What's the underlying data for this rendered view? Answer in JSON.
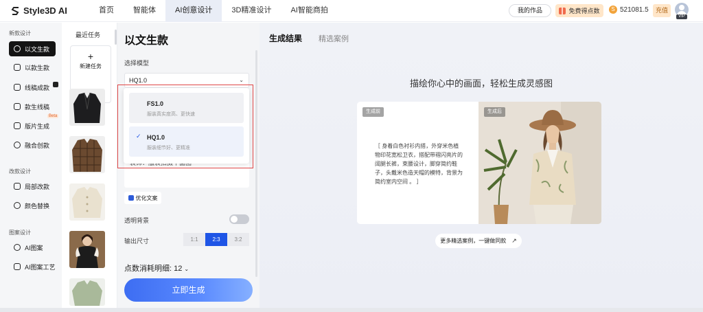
{
  "header": {
    "logo_text": "Style3D AI",
    "nav": [
      "首页",
      "智能体",
      "AI创意设计",
      "3D精准设计",
      "AI智能商拍"
    ],
    "works_label": "我的作品",
    "free_points_label": "免费得点数",
    "balance": "521081.5",
    "recharge_label": "充值",
    "vip_label": "VIP"
  },
  "sidebar": {
    "group1": "新款设计",
    "group2": "改款设计",
    "group3": "图案设计",
    "items": [
      "以文生款",
      "以款生款",
      "线稿成款",
      "款生线稿",
      "版片生成",
      "融合创款",
      "局部改款",
      "颜色替换",
      "AI图案",
      "AI图案工艺"
    ],
    "beta": "Beta"
  },
  "recent": {
    "title": "最近任务",
    "new_task": "新建任务"
  },
  "config": {
    "title": "以文生款",
    "model_label": "选择模型",
    "model_value": "HQ1.0",
    "prompt_text": "装饰：服装拍摄平面图",
    "optimize_label": "优化文案",
    "transparent_label": "透明背景",
    "size_label": "输出尺寸",
    "ratios": [
      "1:1",
      "2:3",
      "3:2"
    ],
    "cost_label": "点数消耗明细: 12",
    "generate_label": "立即生成"
  },
  "dropdown": {
    "options": [
      {
        "name": "FS1.0",
        "desc": "服装真实度高、更快速"
      },
      {
        "name": "HQ1.0",
        "desc": "服装细节好、更精准"
      }
    ]
  },
  "main": {
    "tab_result": "生成结果",
    "tab_cases": "精选案例",
    "headline": "描绘你心中的画面，轻松生成灵感图",
    "before_tag": "生成前",
    "after_tag": "生成后",
    "description": "［ 身着白色衬衫内搭，外穿米色植物印花宽松卫衣，搭配带褶闪亮片的阔腿长裤，束腰设计，脚穿简约鞋子，头戴米色造天帽的模特，背景为简约室内空间 。 ］",
    "more_label": "更多精选案例，一键做同款"
  },
  "colors": {
    "accent": "#1e55e6",
    "highlight": "#e04646"
  }
}
